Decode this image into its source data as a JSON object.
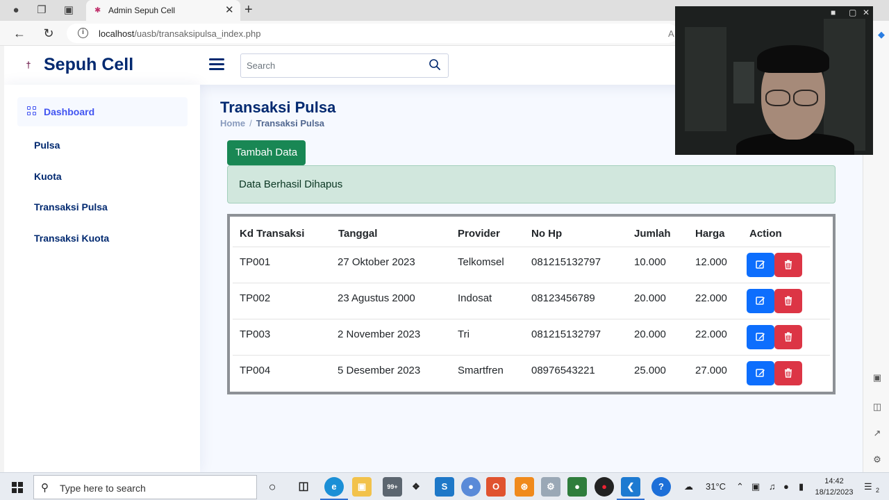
{
  "browser": {
    "tab_title": "Admin Sepuh Cell",
    "url_host": "localhost",
    "url_path": "/uasb/transaksipulsa_index.php",
    "url_tail": "A"
  },
  "app": {
    "brand": "Sepuh Cell",
    "search_placeholder": "Search"
  },
  "sidebar": {
    "items": [
      {
        "label": "Dashboard",
        "active": true
      },
      {
        "label": "Pulsa"
      },
      {
        "label": "Kuota"
      },
      {
        "label": "Transaksi Pulsa"
      },
      {
        "label": "Transaksi Kuota"
      }
    ]
  },
  "main": {
    "title": "Transaksi Pulsa",
    "breadcrumb": [
      "Home",
      "/",
      "Transaksi Pulsa"
    ],
    "add_button": "Tambah Data",
    "alert": "Data Berhasil Dihapus",
    "alert_color": "#d1e7dd",
    "table": {
      "columns": [
        "Kd Transaksi",
        "Tanggal",
        "Provider",
        "No Hp",
        "Jumlah",
        "Harga",
        "Action"
      ],
      "rows": [
        [
          "TP001",
          "27 Oktober 2023",
          "Telkomsel",
          "081215132797",
          "10.000",
          "12.000"
        ],
        [
          "TP002",
          "23 Agustus 2000",
          "Indosat",
          "08123456789",
          "20.000",
          "22.000"
        ],
        [
          "TP003",
          "2 November 2023",
          "Tri",
          "081215132797",
          "20.000",
          "22.000"
        ],
        [
          "TP004",
          "5 Desember 2023",
          "Smartfren",
          "08976543221",
          "25.000",
          "27.000"
        ]
      ]
    }
  },
  "colors": {
    "brand": "#012970",
    "success": "#198754",
    "edit": "#0d6efd",
    "delete": "#dc3545"
  },
  "taskbar": {
    "search_text": "Type here to search",
    "weather": "31°C",
    "time": "14:42",
    "date": "18/12/2023",
    "notification_count": "2",
    "badge": "99+"
  }
}
